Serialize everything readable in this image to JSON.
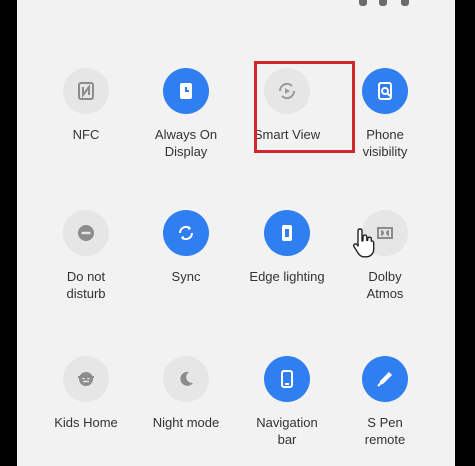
{
  "quick_settings": {
    "tiles": [
      {
        "label": "NFC",
        "state": "off",
        "icon": "nfc-icon"
      },
      {
        "label": "Always On\nDisplay",
        "state": "on",
        "icon": "always-on-display-icon"
      },
      {
        "label": "Smart View",
        "state": "off",
        "icon": "smart-view-icon"
      },
      {
        "label": "Phone\nvisibility",
        "state": "on",
        "icon": "phone-visibility-icon"
      },
      {
        "label": "Do not\ndisturb",
        "state": "off",
        "icon": "do-not-disturb-icon"
      },
      {
        "label": "Sync",
        "state": "on",
        "icon": "sync-icon"
      },
      {
        "label": "Edge lighting",
        "state": "on",
        "icon": "edge-lighting-icon"
      },
      {
        "label": "Dolby\nAtmos",
        "state": "off",
        "icon": "dolby-atmos-icon"
      },
      {
        "label": "Kids Home",
        "state": "off",
        "icon": "kids-home-icon"
      },
      {
        "label": "Night mode",
        "state": "off",
        "icon": "night-mode-icon"
      },
      {
        "label": "Navigation\nbar",
        "state": "on",
        "icon": "navigation-bar-icon"
      },
      {
        "label": "S Pen\nremote",
        "state": "on",
        "icon": "s-pen-remote-icon"
      }
    ]
  },
  "colors": {
    "tile_on": "#2f7ff0",
    "tile_off": "#e6e6e6",
    "highlight": "#d0262c",
    "panel_bg": "#f2f2f2"
  }
}
